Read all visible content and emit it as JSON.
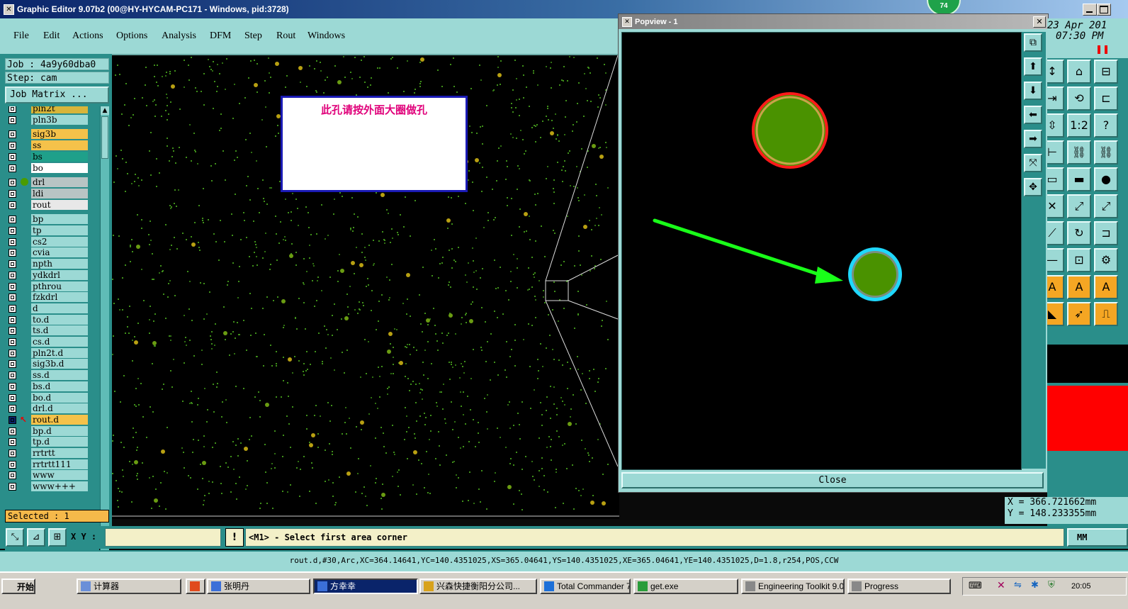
{
  "window": {
    "title": "Graphic Editor 9.07b2 (00@HY-HYCAM-PC171 - Windows, pid:3728)",
    "notification_count": "74"
  },
  "menu": [
    "File",
    "Edit",
    "Actions",
    "Options",
    "Analysis",
    "DFM",
    "Step",
    "Rout",
    "Windows"
  ],
  "job": {
    "job_label": "Job : 4a9y60dba0",
    "step_label": "Step: cam",
    "matrix_button": "Job Matrix ..."
  },
  "layers": [
    {
      "name": "pln2t",
      "color": "#d8b53a",
      "group": 0
    },
    {
      "name": "pln3b",
      "color": "#9cd9d5",
      "group": 0
    },
    {
      "name": "sig3b",
      "color": "#f5c24a",
      "group": 1
    },
    {
      "name": "ss",
      "color": "#f5c24a",
      "group": 1
    },
    {
      "name": "bs",
      "color": "#1fa08a",
      "group": 1
    },
    {
      "name": "bo",
      "color": "#ffffff",
      "group": 1
    },
    {
      "name": "drl",
      "color": "#b8c4c4",
      "group": 2,
      "dot": true
    },
    {
      "name": "ldi",
      "color": "#b8c4c4",
      "group": 2
    },
    {
      "name": "rout",
      "color": "#e8e8e8",
      "group": 2
    },
    {
      "name": "bp",
      "color": "#9cd9d5",
      "group": 3
    },
    {
      "name": "tp",
      "color": "#9cd9d5",
      "group": 3
    },
    {
      "name": "cs2",
      "color": "#9cd9d5",
      "group": 3
    },
    {
      "name": "cvia",
      "color": "#9cd9d5",
      "group": 3
    },
    {
      "name": "npth",
      "color": "#9cd9d5",
      "group": 3
    },
    {
      "name": "ydkdrl",
      "color": "#9cd9d5",
      "group": 3
    },
    {
      "name": "pthrou",
      "color": "#9cd9d5",
      "group": 3
    },
    {
      "name": "fzkdrl",
      "color": "#9cd9d5",
      "group": 3
    },
    {
      "name": "d",
      "color": "#9cd9d5",
      "group": 3
    },
    {
      "name": "to.d",
      "color": "#9cd9d5",
      "group": 3
    },
    {
      "name": "ts.d",
      "color": "#9cd9d5",
      "group": 3
    },
    {
      "name": "cs.d",
      "color": "#9cd9d5",
      "group": 3
    },
    {
      "name": "pln2t.d",
      "color": "#9cd9d5",
      "group": 3
    },
    {
      "name": "sig3b.d",
      "color": "#9cd9d5",
      "group": 3
    },
    {
      "name": "ss.d",
      "color": "#9cd9d5",
      "group": 3
    },
    {
      "name": "bs.d",
      "color": "#9cd9d5",
      "group": 3
    },
    {
      "name": "bo.d",
      "color": "#9cd9d5",
      "group": 3
    },
    {
      "name": "drl.d",
      "color": "#9cd9d5",
      "group": 3
    },
    {
      "name": "rout.d",
      "color": "#f5c24a",
      "group": 3,
      "selected": true
    },
    {
      "name": "bp.d",
      "color": "#9cd9d5",
      "group": 3
    },
    {
      "name": "tp.d",
      "color": "#9cd9d5",
      "group": 3
    },
    {
      "name": "rrtrtt",
      "color": "#9cd9d5",
      "group": 3
    },
    {
      "name": "rrtrtt111",
      "color": "#9cd9d5",
      "group": 3
    },
    {
      "name": "www",
      "color": "#9cd9d5",
      "group": 3
    },
    {
      "name": "www+++",
      "color": "#9cd9d5",
      "group": 3
    }
  ],
  "selected_label": "Selected : 1",
  "annotation": "此孔请按外面大圈做孔",
  "popview": {
    "title": "Popview - 1",
    "close_label": "Close",
    "large_pad": {
      "fill": "#4a9200",
      "ring": "#ff1a1a"
    },
    "small_pad": {
      "fill": "#4a9200",
      "ring": "#1fd8ff"
    },
    "arrow_color": "#19ff19"
  },
  "datetime": {
    "date": "23 Apr 201",
    "time": "07:30 PM"
  },
  "coords": {
    "x": "X = 366.721662mm",
    "y": "Y = 148.233355mm"
  },
  "command": {
    "xy_label": "X Y :",
    "xy_value": "",
    "prompt": "<M1> - Select first area corner",
    "unit": "MM"
  },
  "status_line": "rout.d,#30,Arc,XC=364.14641,YC=140.4351025,XS=365.04641,YS=140.4351025,XE=365.04641,YE=140.4351025,D=1.8,r254,POS,CCW",
  "taskbar": {
    "start": "开始",
    "items": [
      "计算器",
      "",
      "张明丹",
      "方幸幸",
      "兴森快捷衡阳分公司...",
      "Total Commander 7.0 ...",
      "get.exe",
      "Engineering Toolkit 9.0...",
      "Progress"
    ],
    "active_index": 3,
    "clock": "20:05"
  }
}
